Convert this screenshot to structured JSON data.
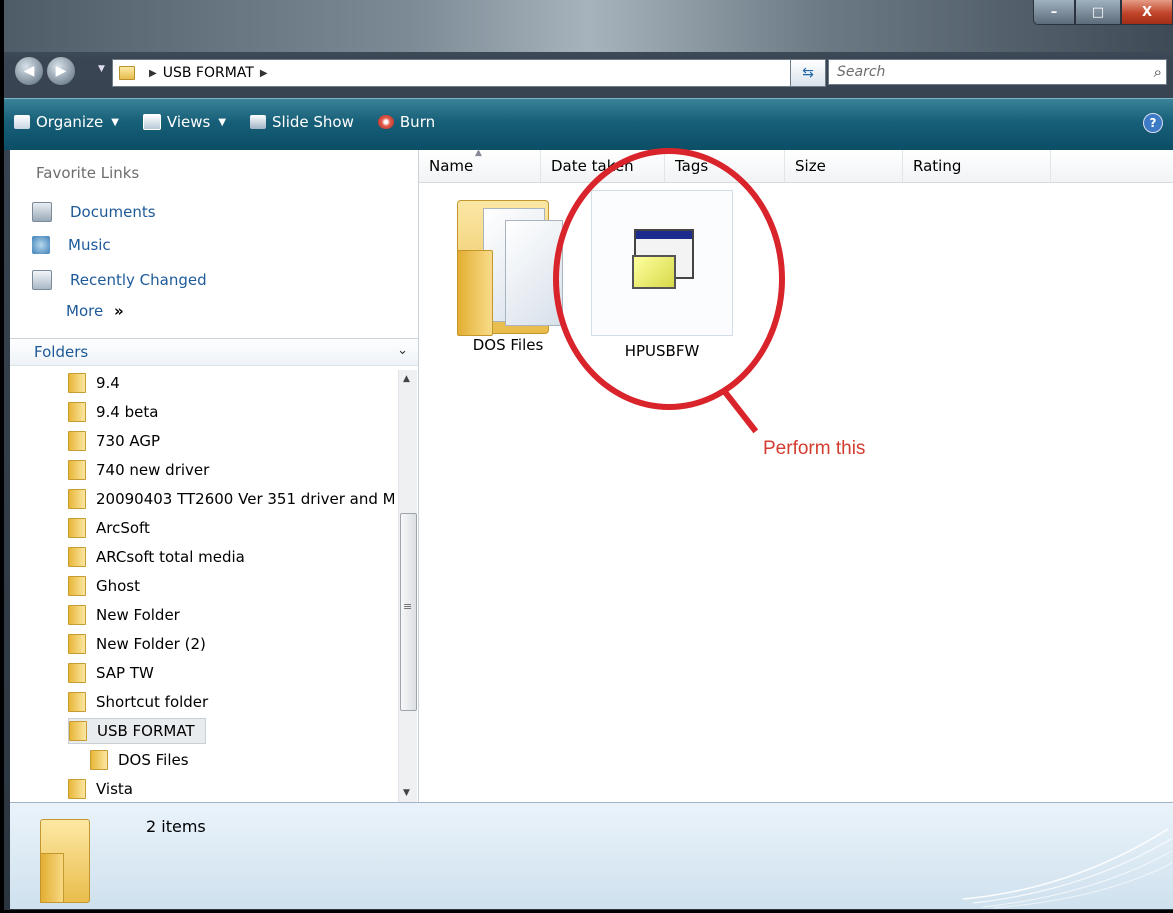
{
  "window": {
    "controls": {
      "minimize": "–",
      "maximize": "□",
      "close": "X"
    }
  },
  "nav": {
    "back_icon": "back-arrow-icon",
    "forward_icon": "forward-arrow-icon",
    "address_path": "USB FORMAT",
    "search_placeholder": "Search"
  },
  "toolbar": {
    "organize": "Organize",
    "views": "Views",
    "slideshow": "Slide Show",
    "burn": "Burn",
    "help": "?"
  },
  "sidebar": {
    "favorite_title": "Favorite Links",
    "favorites": [
      {
        "label": "Documents",
        "icon": "documents-icon"
      },
      {
        "label": "Music",
        "icon": "music-icon"
      },
      {
        "label": "Recently Changed",
        "icon": "recently-changed-icon"
      }
    ],
    "more": "More",
    "more_glyph": "»",
    "folders_title": "Folders",
    "tree": [
      {
        "label": "9.4",
        "indent": 0
      },
      {
        "label": "9.4 beta",
        "indent": 0
      },
      {
        "label": "730 AGP",
        "indent": 0
      },
      {
        "label": "740 new driver",
        "indent": 0
      },
      {
        "label": "20090403 TT2600 Ver 351 driver  and M",
        "indent": 0
      },
      {
        "label": "ArcSoft",
        "indent": 0
      },
      {
        "label": "ARCsoft total media",
        "indent": 0
      },
      {
        "label": "Ghost",
        "indent": 0
      },
      {
        "label": "New Folder",
        "indent": 0
      },
      {
        "label": "New Folder (2)",
        "indent": 0
      },
      {
        "label": "SAP TW",
        "indent": 0
      },
      {
        "label": "Shortcut folder",
        "indent": 0
      },
      {
        "label": "USB FORMAT",
        "indent": 0,
        "selected": true
      },
      {
        "label": "DOS Files",
        "indent": 1
      },
      {
        "label": "Vista",
        "indent": 0
      }
    ]
  },
  "columns": [
    "Name",
    "Date taken",
    "Tags",
    "Size",
    "Rating"
  ],
  "items": [
    {
      "name": "DOS Files",
      "type": "folder"
    },
    {
      "name": "HPUSBFW",
      "type": "application"
    }
  ],
  "annotation": {
    "text": "Perform this",
    "color": "#d8242a"
  },
  "status": {
    "count": "2 items"
  }
}
